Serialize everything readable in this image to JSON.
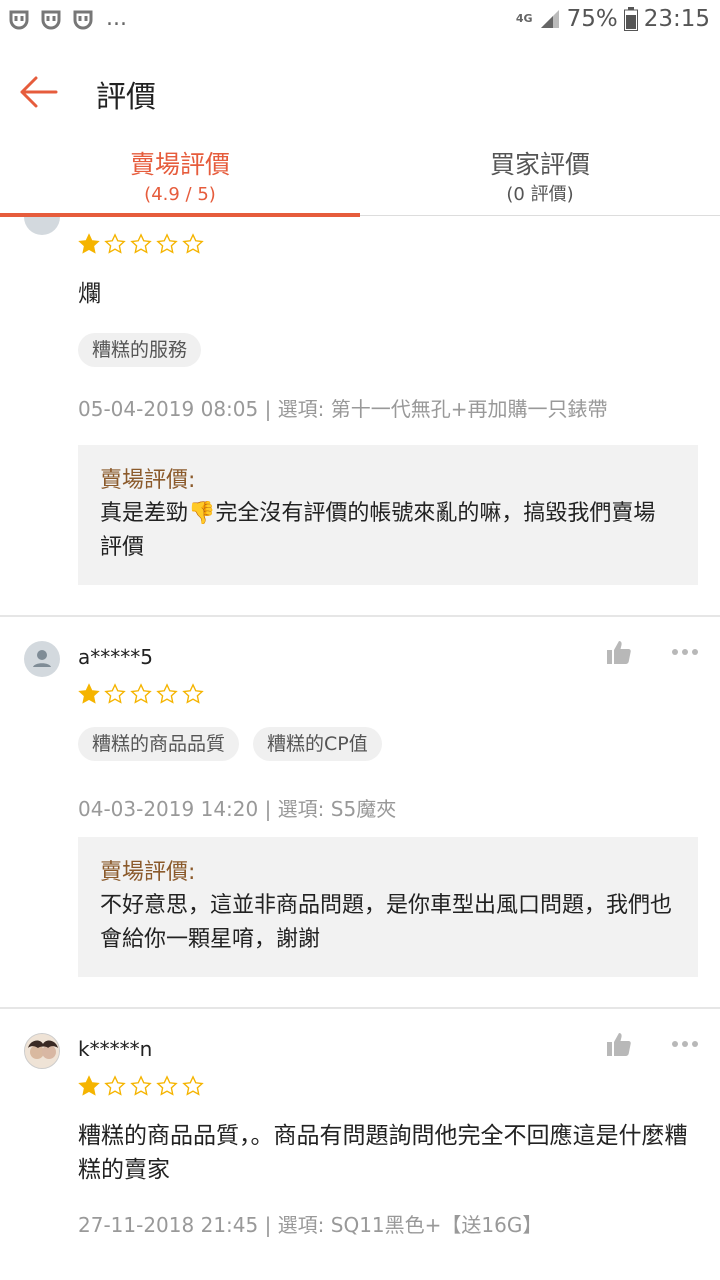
{
  "status_bar": {
    "network": "4G",
    "battery": "75%",
    "time": "23:15",
    "overflow": "..."
  },
  "header": {
    "title": "評價"
  },
  "tabs": [
    {
      "label": "賣場評價",
      "sub": "(4.9 / 5)",
      "active": true
    },
    {
      "label": "買家評價",
      "sub": "(0 評價)",
      "active": false
    }
  ],
  "reviews": [
    {
      "username": "",
      "rating": 1,
      "comment": "爛",
      "tags": [
        "糟糕的服務"
      ],
      "meta": "05-04-2019 08:05 | 選項: 第十一代無孔+再加購一只錶帶",
      "reply_title": "賣場評價:",
      "reply_text": "真是差勁👎完全沒有評價的帳號來亂的嘛，搞毀我們賣場評價"
    },
    {
      "username": "a*****5",
      "rating": 1,
      "tags": [
        "糟糕的商品品質",
        "糟糕的CP值"
      ],
      "meta": "04-03-2019 14:20 | 選項: S5魔夾",
      "reply_title": "賣場評價:",
      "reply_text": "不好意思，這並非商品問題，是你車型出風口問題，我們也會給你一顆星唷，謝謝"
    },
    {
      "username": "k*****n",
      "rating": 1,
      "comment": "糟糕的商品品質，。商品有問題詢問他完全不回應這是什麼糟糕的賣家",
      "meta": "27-11-2018 21:45 | 選項: SQ11黑色+【送16G】"
    }
  ],
  "colors": {
    "accent": "#e65c3c",
    "star": "#f5b400",
    "reply_title": "#8b5a2b"
  }
}
